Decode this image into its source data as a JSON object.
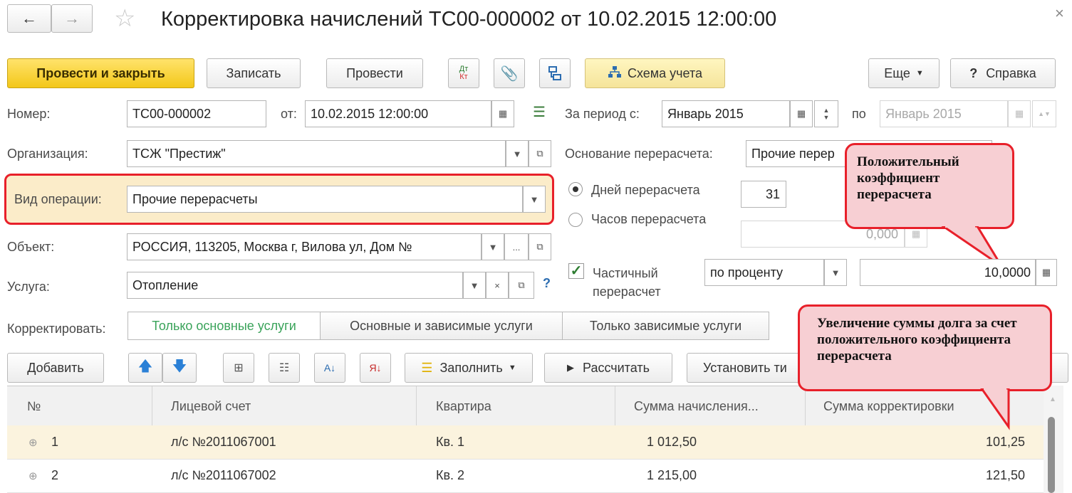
{
  "window": {
    "title": "Корректировка начислений ТС00-000002 от 10.02.2015 12:00:00",
    "close_glyph": "×"
  },
  "toolbar": {
    "post_close": "Провести и закрыть",
    "save": "Записать",
    "post": "Провести",
    "dt_kt_top": "Дт",
    "dt_kt_bottom": "Кт",
    "scheme": "Схема учета",
    "more": "Еще",
    "help": "Справка",
    "help_glyph": "?"
  },
  "form": {
    "number_label": "Номер:",
    "number_value": "ТС00-000002",
    "date_label": "от:",
    "date_value": "10.02.2015 12:00:00",
    "org_label": "Организация:",
    "org_value": "ТСЖ \"Престиж\"",
    "op_label": "Вид операции:",
    "op_value": "Прочие перерасчеты",
    "object_label": "Объект:",
    "object_value": "РОССИЯ, 113205, Москва г, Вилова ул, Дом №",
    "service_label": "Услуга:",
    "service_value": "Отопление",
    "help_q": "?",
    "period_label": "За период с:",
    "period_from": "Январь 2015",
    "period_to_label": "по",
    "period_to": "Январь 2015",
    "basis_label": "Основание перерасчета:",
    "basis_value": "Прочие перер",
    "days_label": "Дней перерасчета",
    "days_value": "31",
    "hours_label": "Часов перерасчета",
    "hours_value": "0,000",
    "partial_label_1": "Частичный",
    "partial_label_2": "перерасчет",
    "partial_mode": "по проценту",
    "coef_value": "10,0000",
    "correct_label": "Корректировать:",
    "correct_options": [
      "Только основные услуги",
      "Основные и зависимые услуги",
      "Только зависимые услуги"
    ]
  },
  "table_toolbar": {
    "add": "Добавить",
    "fill": "Заполнить",
    "calc": "Рассчитать",
    "set_type": "Установить ти"
  },
  "table": {
    "columns": [
      "№",
      "Лицевой счет",
      "Квартира",
      "Сумма начисления...",
      "Сумма корректировки"
    ],
    "rows": [
      {
        "n": "1",
        "account": "л/с №2011067001",
        "flat": "Кв. 1",
        "sum": "1 012,50",
        "corr": "101,25"
      },
      {
        "n": "2",
        "account": "л/с №2011067002",
        "flat": "Кв. 2",
        "sum": "1 215,00",
        "corr": "121,50"
      }
    ]
  },
  "callouts": {
    "coef": "Положительный коэффициент перерасчета",
    "debt": "Увеличение суммы долга за счет положительного коэффициента перерасчета"
  },
  "colors": {
    "accent_yellow": "#f3c719",
    "callout_fill": "#f7cfd3",
    "callout_border": "#e8202a",
    "row_highlight": "#fbf3de",
    "selected_tab_text": "#3aa35a"
  }
}
